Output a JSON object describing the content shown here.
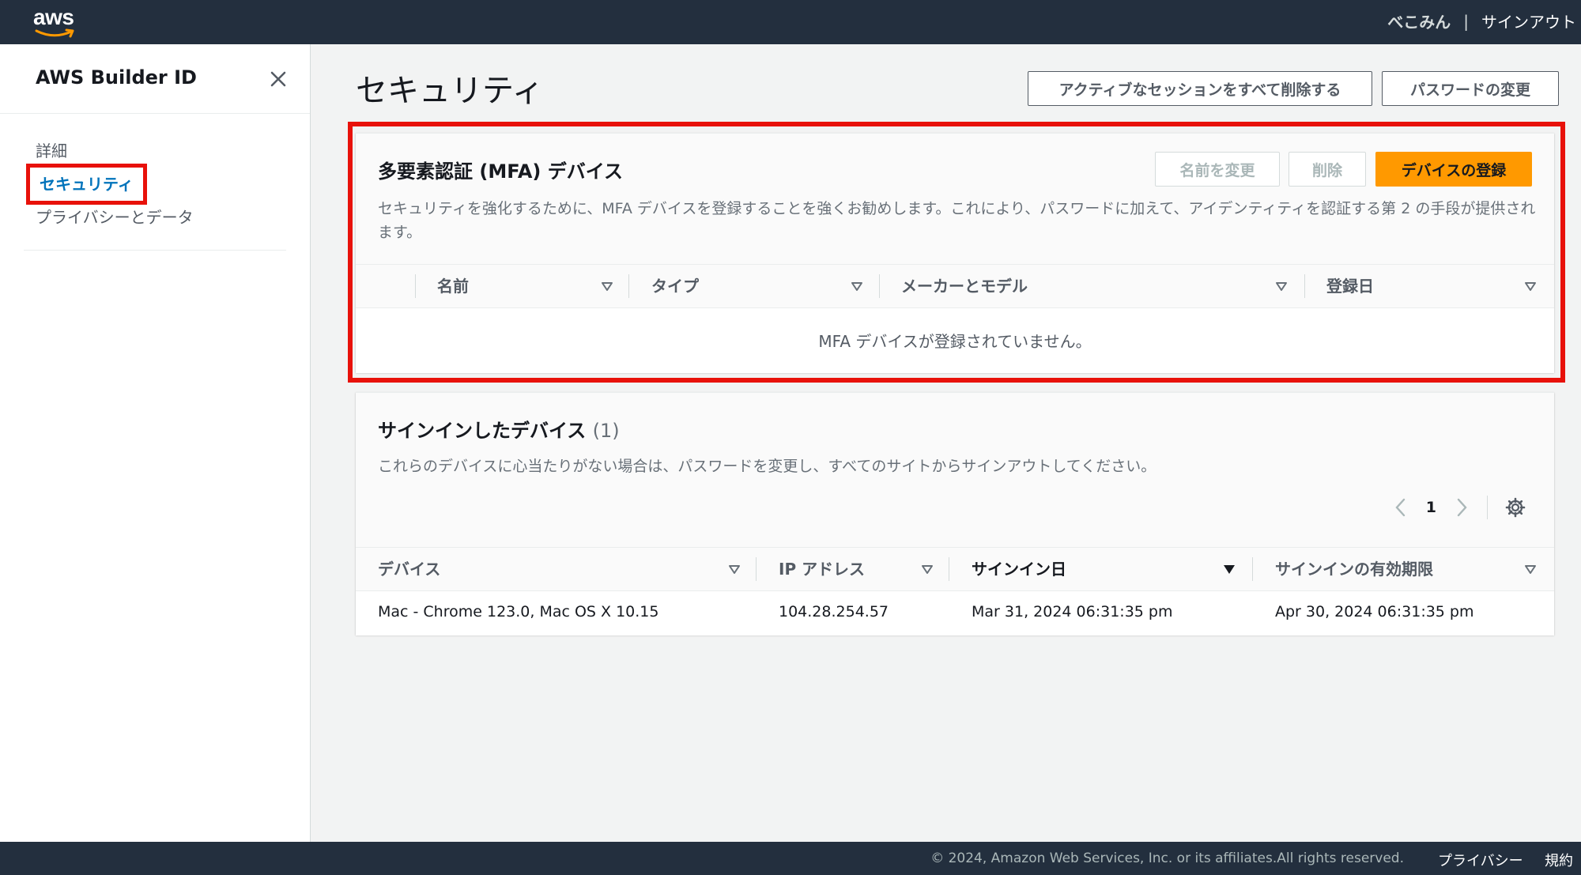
{
  "topnav": {
    "logo_text": "aws",
    "user": "べこみん",
    "separator": "|",
    "signout": "サインアウト"
  },
  "sidebar": {
    "title": "AWS Builder ID",
    "items": [
      {
        "label": "詳細"
      },
      {
        "label": "セキュリティ"
      },
      {
        "label": "プライバシーとデータ"
      }
    ]
  },
  "page": {
    "title": "セキュリティ",
    "revoke_sessions_label": "アクティブなセッションをすべて削除する",
    "change_password_label": "パスワードの変更"
  },
  "mfa": {
    "heading": "多要素認証 (MFA) デバイス",
    "rename_label": "名前を変更",
    "delete_label": "削除",
    "register_label": "デバイスの登録",
    "description": "セキュリティを強化するために、MFA デバイスを登録することを強くお勧めします。これにより、パスワードに加えて、アイデンティティを認証する第 2 の手段が提供されます。",
    "columns": [
      "名前",
      "タイプ",
      "メーカーとモデル",
      "登録日"
    ],
    "empty_text": "MFA デバイスが登録されていません。"
  },
  "devices": {
    "heading": "サインインしたデバイス",
    "count": "(1)",
    "description": "これらのデバイスに心当たりがない場合は、パスワードを変更し、すべてのサイトからサインアウトしてください。",
    "page_number": "1",
    "columns": [
      "デバイス",
      "IP アドレス",
      "サインイン日",
      "サインインの有効期限"
    ],
    "rows": [
      {
        "device": "Mac - Chrome 123.0, Mac OS X 10.15",
        "ip": "104.28.254.57",
        "signin_date": "Mar 31, 2024 06:31:35 pm",
        "expiry": "Apr 30, 2024 06:31:35 pm"
      }
    ]
  },
  "footer": {
    "copyright": "© 2024, Amazon Web Services, Inc. or its affiliates.All rights reserved.",
    "privacy": "プライバシー",
    "terms": "規約"
  },
  "colors": {
    "nav_bg": "#232f3e",
    "accent_orange": "#ff9900",
    "link_blue": "#0073bb",
    "highlight_red": "#e8110a"
  }
}
